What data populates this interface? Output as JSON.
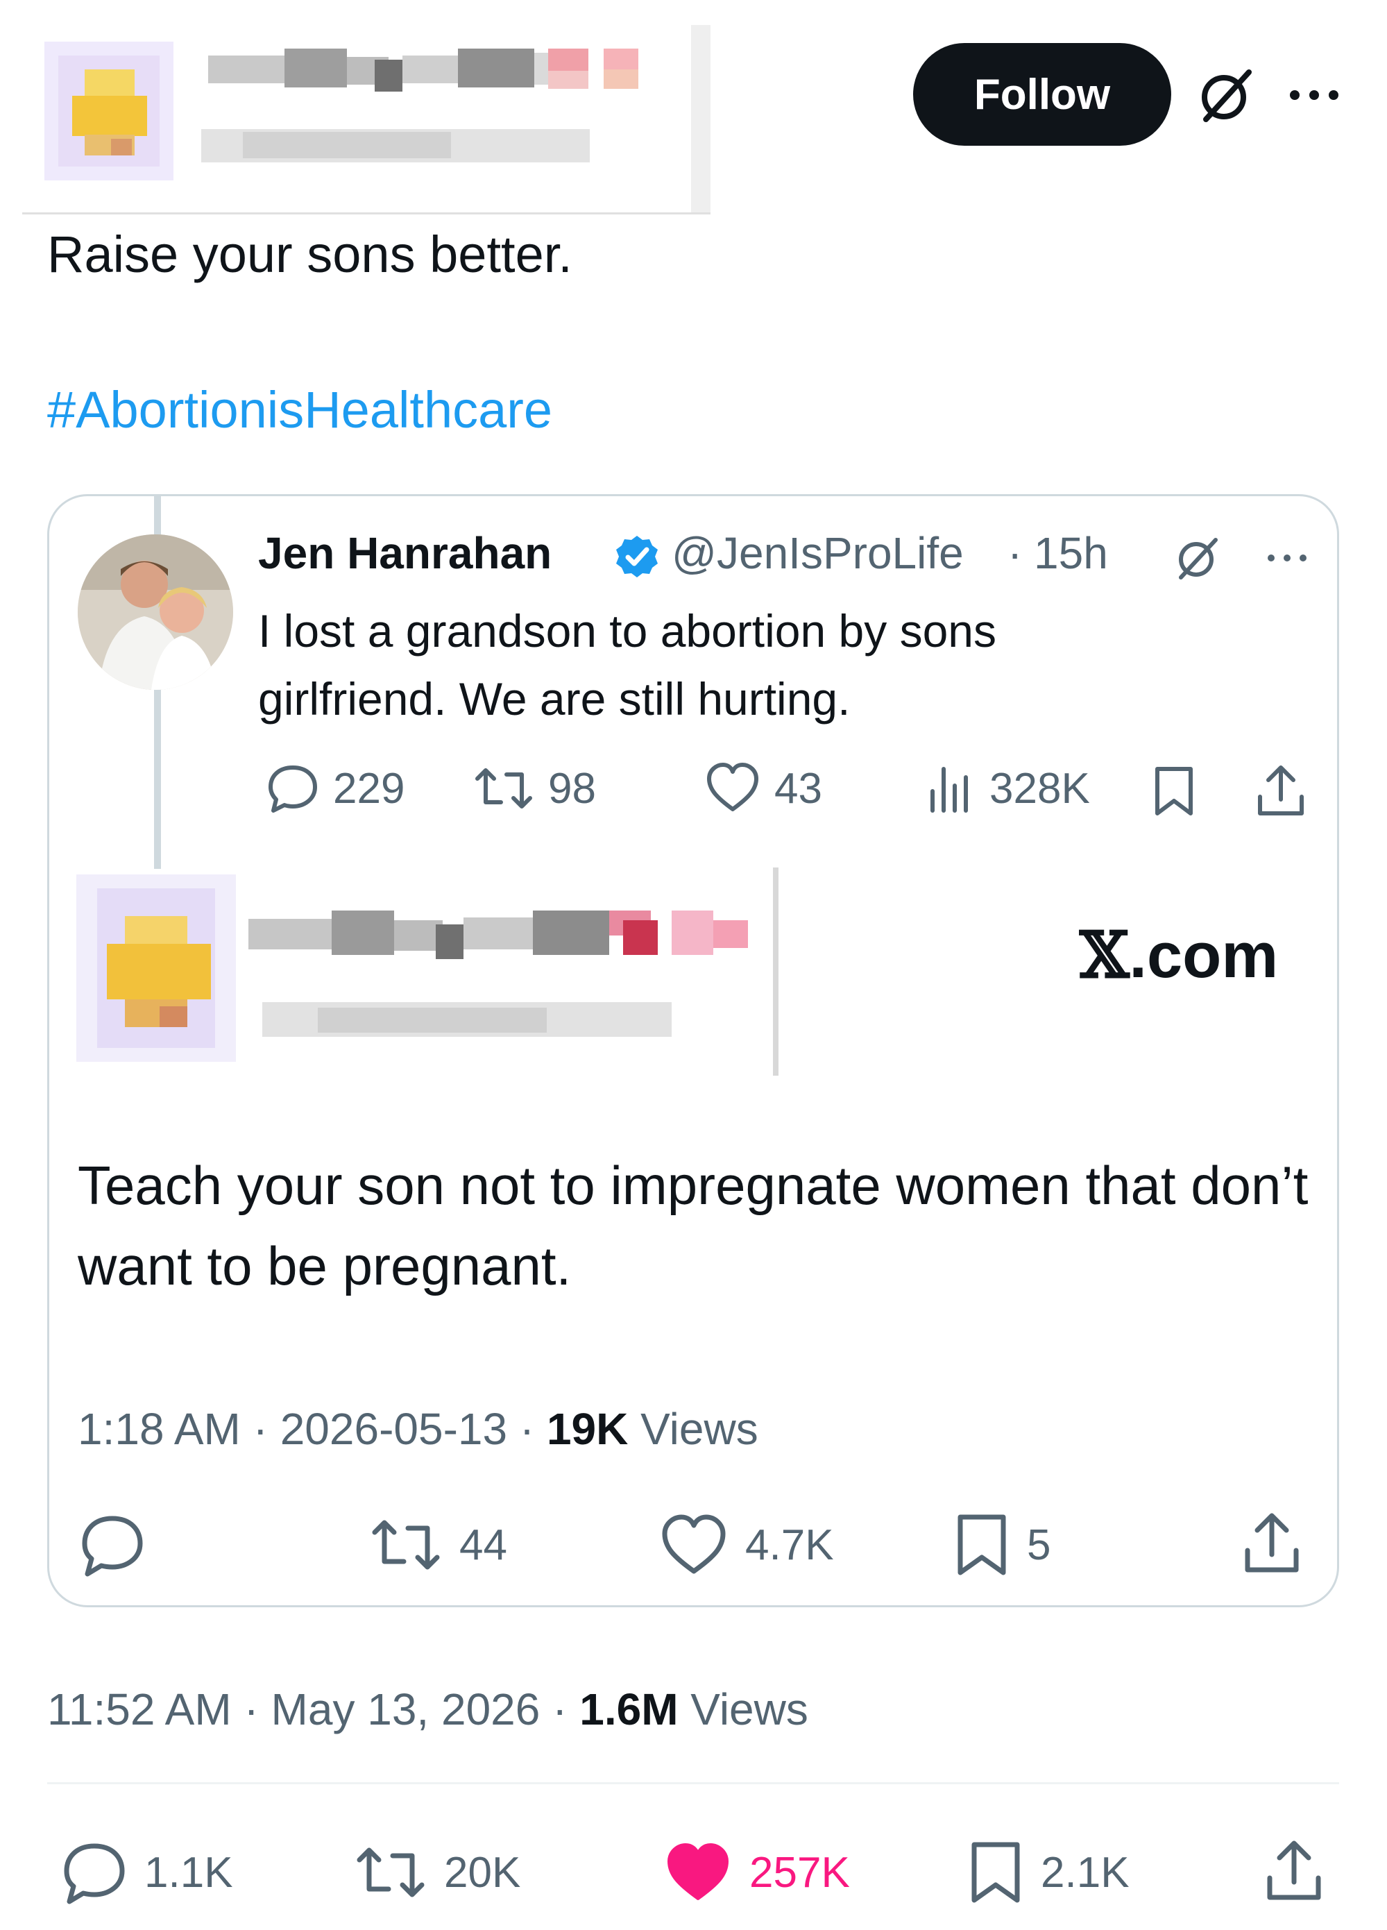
{
  "header": {
    "follow_label": "Follow"
  },
  "post": {
    "text": "Raise your sons better.",
    "hashtag": "#AbortionisHealthcare",
    "time": "11:52 AM",
    "date": "May 13, 2026",
    "views_count": "1.6M",
    "views_label": "Views",
    "stats": {
      "replies": "1.1K",
      "reposts": "20K",
      "likes": "257K",
      "bookmarks": "2.1K"
    }
  },
  "quoted": {
    "original": {
      "name": "Jen Hanrahan",
      "handle": "@JenIsProLife",
      "age": "15h",
      "text": "I lost a grandson to abortion by sons girlfriend. We are still hurting.",
      "stats": {
        "replies": "229",
        "reposts": "98",
        "likes": "43",
        "views": "328K"
      }
    },
    "source_label": ".com",
    "reply_text": "Teach your son not to impregnate women that don’t want to be pregnant.",
    "time": "1:18 AM",
    "date": "2026-05-13",
    "views_count": "19K",
    "views_label": "Views",
    "stats": {
      "reposts": "44",
      "likes": "4.7K",
      "bookmarks": "5"
    }
  },
  "colors": {
    "text": "#0f1419",
    "muted": "#536471",
    "link": "#1d9bf0",
    "like_active": "#f91880",
    "verified": "#1d9bf0",
    "follow_bg": "#0f1419"
  },
  "separator": "·",
  "icons": [
    "grok-icon",
    "more-icon",
    "verified-icon",
    "reply-icon",
    "repost-icon",
    "like-icon",
    "views-icon",
    "bookmark-icon",
    "share-icon",
    "x-logo-icon"
  ]
}
